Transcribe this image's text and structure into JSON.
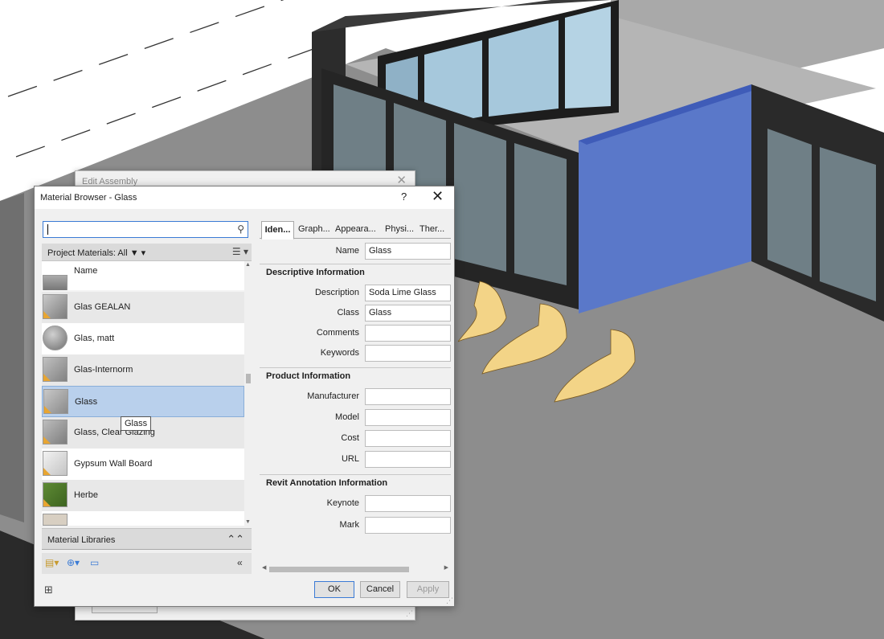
{
  "background_dialog": {
    "title": "Edit Assembly",
    "close_glyph": "✕"
  },
  "material_browser": {
    "title": "Material Browser - Glass",
    "help_glyph": "?",
    "close_glyph": "✕",
    "search": {
      "value": "",
      "icon": "search-icon"
    },
    "filter": {
      "label": "Project Materials: All ▼ ▾",
      "view_icon": "☰ ▾"
    },
    "list": {
      "header_label": "Name",
      "items": [
        {
          "label": "Glas GEALAN",
          "thumb_color": "#9a9a9a"
        },
        {
          "label": "Glas, matt",
          "thumb_color": "#8c8c8c"
        },
        {
          "label": "Glas-Internorm",
          "thumb_color": "#9e9e9e"
        },
        {
          "label": "Glass",
          "thumb_color": "#a4a4a4",
          "selected": true
        },
        {
          "label": "Glass, Clear Glazing",
          "thumb_color": "#9a9a9a"
        },
        {
          "label": "Gypsum Wall Board",
          "thumb_color": "#e6e6e6"
        },
        {
          "label": "Herbe",
          "thumb_color": "#4f7a2b"
        }
      ],
      "tooltip": "Glass"
    },
    "libraries": {
      "label": "Material Libraries",
      "collapse_glyph": "⌃⌃",
      "expand_glyph": "«"
    },
    "tabs": [
      {
        "label": "Iden...",
        "active": true
      },
      {
        "label": "Graph..."
      },
      {
        "label": "Appeara..."
      },
      {
        "label": "Physi..."
      },
      {
        "label": "Ther..."
      }
    ],
    "identity": {
      "name": {
        "label": "Name",
        "value": "Glass"
      },
      "descriptive_heading": "Descriptive Information",
      "description": {
        "label": "Description",
        "value": "Soda Lime Glass"
      },
      "class": {
        "label": "Class",
        "value": "Glass"
      },
      "comments": {
        "label": "Comments",
        "value": ""
      },
      "keywords": {
        "label": "Keywords",
        "value": ""
      },
      "product_heading": "Product Information",
      "manufacturer": {
        "label": "Manufacturer",
        "value": ""
      },
      "model": {
        "label": "Model",
        "value": ""
      },
      "cost": {
        "label": "Cost",
        "value": ""
      },
      "url": {
        "label": "URL",
        "value": ""
      },
      "annotation_heading": "Revit Annotation Information",
      "keynote": {
        "label": "Keynote",
        "value": ""
      },
      "mark": {
        "label": "Mark",
        "value": ""
      }
    },
    "buttons": {
      "ok": "OK",
      "cancel": "Cancel",
      "apply": "Apply"
    }
  },
  "colors": {
    "accent_blue": "#3b7bd5",
    "selection": "#b9d0ec",
    "wall_highlight": "#5a78c9",
    "furniture": "#f3d487"
  }
}
